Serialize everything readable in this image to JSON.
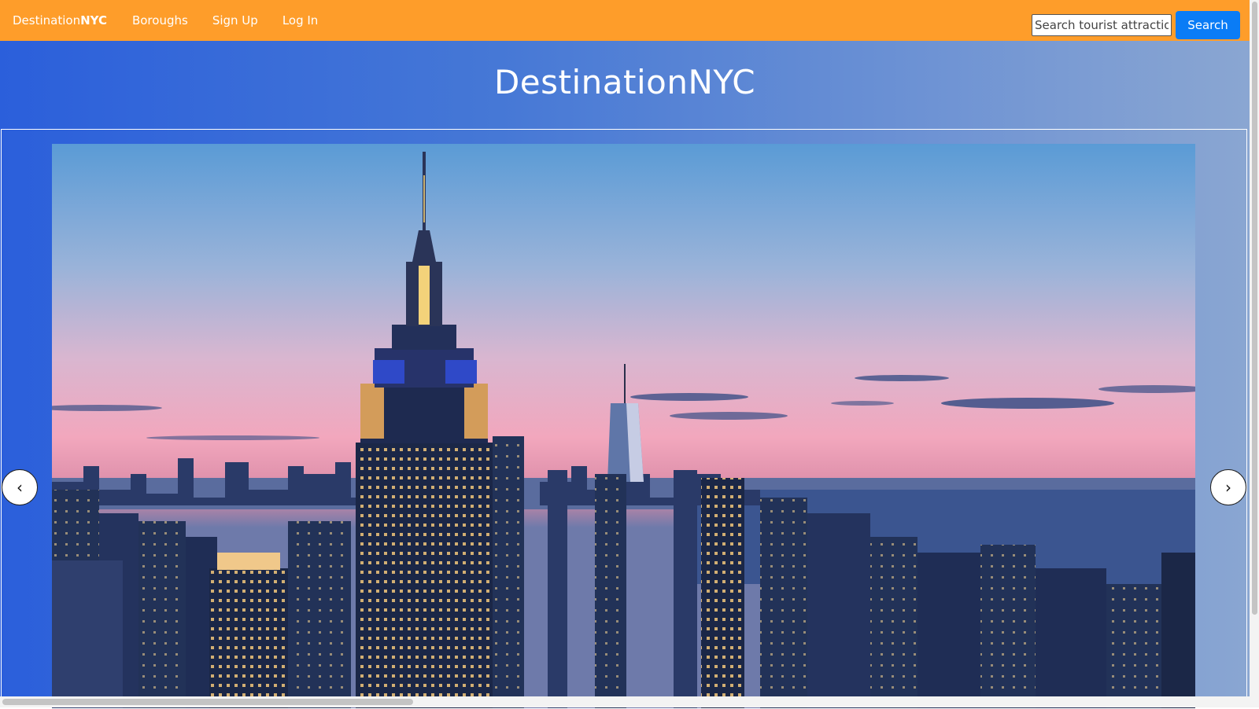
{
  "navbar": {
    "brand_regular": "Destination",
    "brand_bold": "NYC",
    "links": [
      "Boroughs",
      "Sign Up",
      "Log In"
    ],
    "search_placeholder": "Search tourist attraction",
    "search_button": "Search",
    "background_color": "#fe9d2a",
    "button_color": "#0a7cf6"
  },
  "hero": {
    "title": "DestinationNYC",
    "slide_image": "nyc-skyline-dusk-empire-state-building",
    "prev_icon": "chevron-left-icon",
    "next_icon": "chevron-right-icon",
    "prev_glyph": "‹",
    "next_glyph": "›"
  }
}
